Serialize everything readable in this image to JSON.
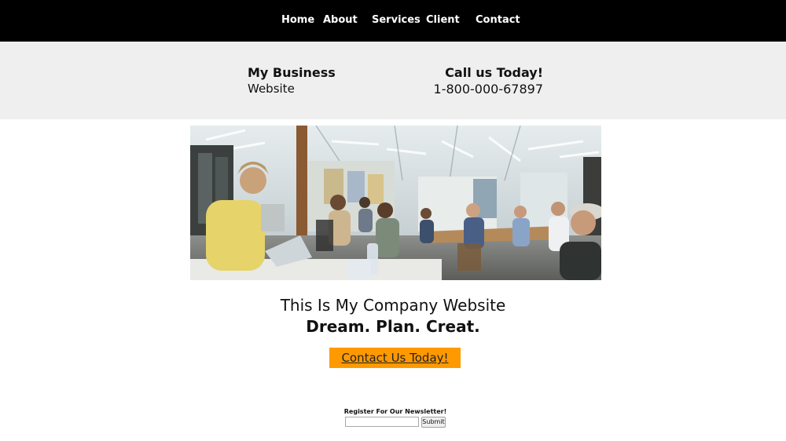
{
  "nav": {
    "items": [
      {
        "label": "Home"
      },
      {
        "label": "About"
      },
      {
        "label": "Services"
      },
      {
        "label": "Client"
      },
      {
        "label": "Contact"
      }
    ]
  },
  "header": {
    "brand_name": "My Business",
    "brand_sub": "Website",
    "call_title": "Call us Today!",
    "call_phone": "1-800-000-67897"
  },
  "hero": {
    "image_description_icon": "office-meeting-photo"
  },
  "main": {
    "headline": "This Is My Company Website",
    "tagline": "Dream. Plan. Creat.",
    "cta_label": "Contact Us Today!"
  },
  "newsletter": {
    "label": "Register For Our Newsletter!",
    "input_value": "",
    "submit_label": "Submit"
  },
  "colors": {
    "nav_bg": "#000000",
    "header_band": "#efefef",
    "cta_bg": "#ff9900"
  }
}
